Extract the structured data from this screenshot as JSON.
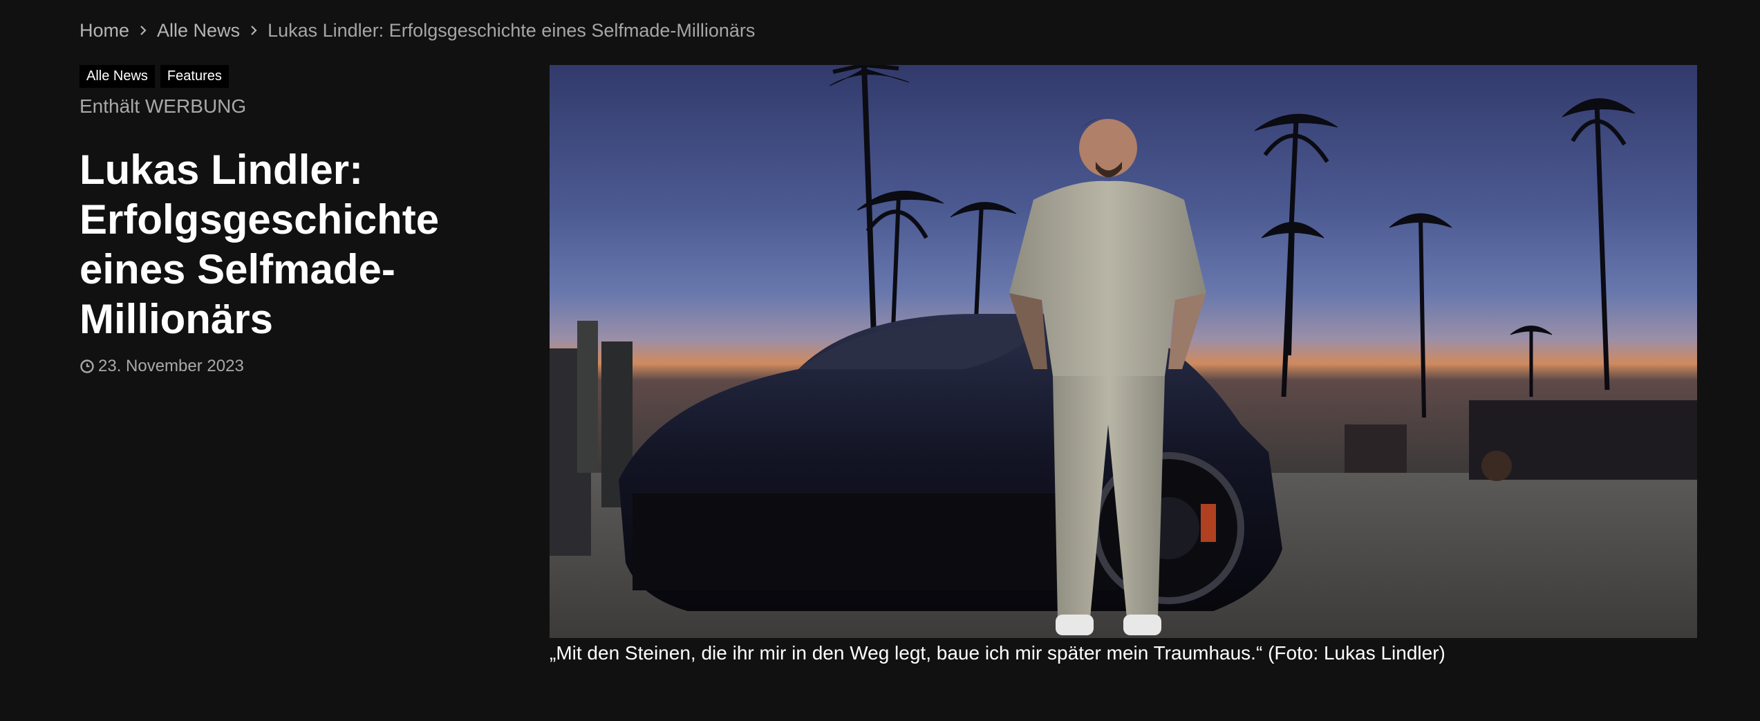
{
  "breadcrumb": {
    "items": [
      "Home",
      "Alle News",
      "Lukas Lindler: Erfolgsgeschichte eines Selfmade-Millionärs"
    ],
    "separator_icon": "chevron-right-icon"
  },
  "article": {
    "tags": [
      "Alle News",
      "Features"
    ],
    "ad_notice": "Enthält WERBUNG",
    "title": "Lukas Lindler: Erfolgsgeschichte eines Selfmade-Millionärs",
    "date": "23. November 2023",
    "date_icon": "clock-icon"
  },
  "figure": {
    "caption": "„Mit den Steinen, die ihr mir in den Weg legt, baue ich mir später mein Traumhaus.“ (Foto: Lukas Lindler)"
  },
  "colors": {
    "background": "#111111",
    "text": "#ffffff",
    "muted_text": "#a9a9a9",
    "tag_background": "#000000"
  }
}
